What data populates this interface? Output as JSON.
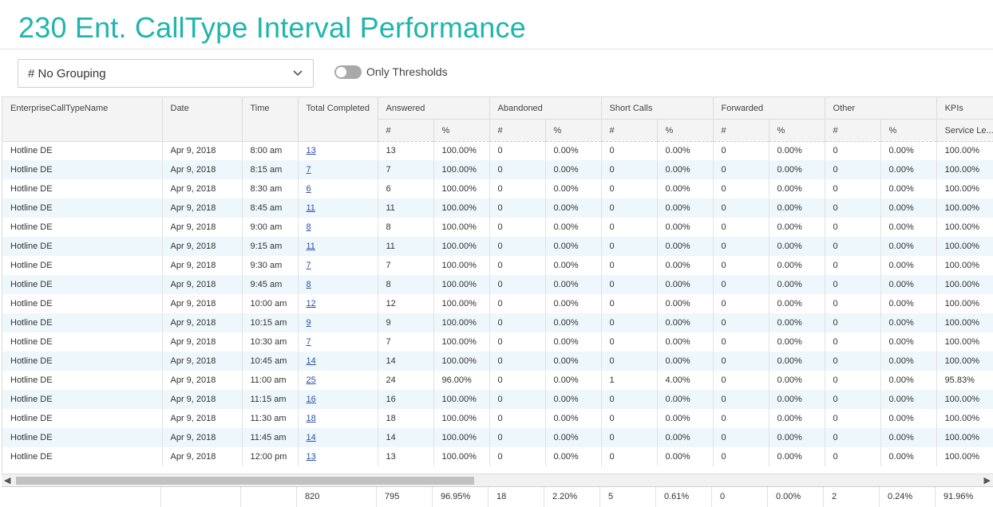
{
  "page": {
    "title": "230 Ent. CallType Interval Performance"
  },
  "controls": {
    "grouping_value": "# No Grouping",
    "toggle_label": "Only Thresholds",
    "toggle_on": false
  },
  "table": {
    "group_headers": {
      "name": "EnterpriseCallTypeName",
      "date": "Date",
      "time": "Time",
      "total": "Total Completed",
      "answered": "Answered",
      "abandoned": "Abandoned",
      "short_calls": "Short Calls",
      "forwarded": "Forwarded",
      "other": "Other",
      "kpis": "KPIs"
    },
    "sub_headers": {
      "count": "#",
      "pct": "%",
      "service_level": "Service Le..."
    },
    "rows": [
      [
        "Hotline DE",
        "Apr 9, 2018",
        "8:00 am",
        "13",
        "13",
        "100.00%",
        "0",
        "0.00%",
        "0",
        "0.00%",
        "0",
        "0.00%",
        "0",
        "0.00%",
        "100.00%"
      ],
      [
        "Hotline DE",
        "Apr 9, 2018",
        "8:15 am",
        "7",
        "7",
        "100.00%",
        "0",
        "0.00%",
        "0",
        "0.00%",
        "0",
        "0.00%",
        "0",
        "0.00%",
        "100.00%"
      ],
      [
        "Hotline DE",
        "Apr 9, 2018",
        "8:30 am",
        "6",
        "6",
        "100.00%",
        "0",
        "0.00%",
        "0",
        "0.00%",
        "0",
        "0.00%",
        "0",
        "0.00%",
        "100.00%"
      ],
      [
        "Hotline DE",
        "Apr 9, 2018",
        "8:45 am",
        "11",
        "11",
        "100.00%",
        "0",
        "0.00%",
        "0",
        "0.00%",
        "0",
        "0.00%",
        "0",
        "0.00%",
        "100.00%"
      ],
      [
        "Hotline DE",
        "Apr 9, 2018",
        "9:00 am",
        "8",
        "8",
        "100.00%",
        "0",
        "0.00%",
        "0",
        "0.00%",
        "0",
        "0.00%",
        "0",
        "0.00%",
        "100.00%"
      ],
      [
        "Hotline DE",
        "Apr 9, 2018",
        "9:15 am",
        "11",
        "11",
        "100.00%",
        "0",
        "0.00%",
        "0",
        "0.00%",
        "0",
        "0.00%",
        "0",
        "0.00%",
        "100.00%"
      ],
      [
        "Hotline DE",
        "Apr 9, 2018",
        "9:30 am",
        "7",
        "7",
        "100.00%",
        "0",
        "0.00%",
        "0",
        "0.00%",
        "0",
        "0.00%",
        "0",
        "0.00%",
        "100.00%"
      ],
      [
        "Hotline DE",
        "Apr 9, 2018",
        "9:45 am",
        "8",
        "8",
        "100.00%",
        "0",
        "0.00%",
        "0",
        "0.00%",
        "0",
        "0.00%",
        "0",
        "0.00%",
        "100.00%"
      ],
      [
        "Hotline DE",
        "Apr 9, 2018",
        "10:00 am",
        "12",
        "12",
        "100.00%",
        "0",
        "0.00%",
        "0",
        "0.00%",
        "0",
        "0.00%",
        "0",
        "0.00%",
        "100.00%"
      ],
      [
        "Hotline DE",
        "Apr 9, 2018",
        "10:15 am",
        "9",
        "9",
        "100.00%",
        "0",
        "0.00%",
        "0",
        "0.00%",
        "0",
        "0.00%",
        "0",
        "0.00%",
        "100.00%"
      ],
      [
        "Hotline DE",
        "Apr 9, 2018",
        "10:30 am",
        "7",
        "7",
        "100.00%",
        "0",
        "0.00%",
        "0",
        "0.00%",
        "0",
        "0.00%",
        "0",
        "0.00%",
        "100.00%"
      ],
      [
        "Hotline DE",
        "Apr 9, 2018",
        "10:45 am",
        "14",
        "14",
        "100.00%",
        "0",
        "0.00%",
        "0",
        "0.00%",
        "0",
        "0.00%",
        "0",
        "0.00%",
        "100.00%"
      ],
      [
        "Hotline DE",
        "Apr 9, 2018",
        "11:00 am",
        "25",
        "24",
        "96.00%",
        "0",
        "0.00%",
        "1",
        "4.00%",
        "0",
        "0.00%",
        "0",
        "0.00%",
        "95.83%"
      ],
      [
        "Hotline DE",
        "Apr 9, 2018",
        "11:15 am",
        "16",
        "16",
        "100.00%",
        "0",
        "0.00%",
        "0",
        "0.00%",
        "0",
        "0.00%",
        "0",
        "0.00%",
        "100.00%"
      ],
      [
        "Hotline DE",
        "Apr 9, 2018",
        "11:30 am",
        "18",
        "18",
        "100.00%",
        "0",
        "0.00%",
        "0",
        "0.00%",
        "0",
        "0.00%",
        "0",
        "0.00%",
        "100.00%"
      ],
      [
        "Hotline DE",
        "Apr 9, 2018",
        "11:45 am",
        "14",
        "14",
        "100.00%",
        "0",
        "0.00%",
        "0",
        "0.00%",
        "0",
        "0.00%",
        "0",
        "0.00%",
        "100.00%"
      ],
      [
        "Hotline DE",
        "Apr 9, 2018",
        "12:00 pm",
        "13",
        "13",
        "100.00%",
        "0",
        "0.00%",
        "0",
        "0.00%",
        "0",
        "0.00%",
        "0",
        "0.00%",
        "100.00%"
      ]
    ],
    "totals": [
      "",
      "",
      "",
      "820",
      "795",
      "96.95%",
      "18",
      "2.20%",
      "5",
      "0.61%",
      "0",
      "0.00%",
      "2",
      "0.24%",
      "91.96%"
    ]
  },
  "colors": {
    "title": "#1fb5ad",
    "row_alt": "#eef7fb",
    "link": "#2a4fa8"
  },
  "icons": {
    "select": "chevron-down-icon",
    "scroll_left": "arrow-left-icon",
    "scroll_right": "arrow-right-icon"
  }
}
